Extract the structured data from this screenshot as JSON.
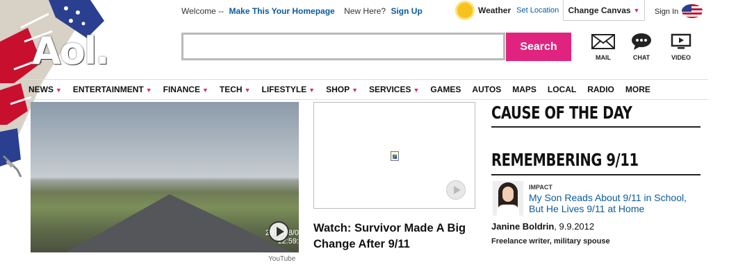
{
  "logo": {
    "text": "Aol."
  },
  "header": {
    "welcome": "Welcome --",
    "homepage_link": "Make This Your Homepage",
    "new_here": "New Here?",
    "signup": "Sign Up",
    "weather_label": "Weather",
    "weather_link": "Set Location",
    "change_canvas": "Change Canvas",
    "sign_in": "Sign In"
  },
  "search": {
    "value": "",
    "button": "Search"
  },
  "utilities": [
    {
      "label": "MAIL",
      "icon": "mail-icon"
    },
    {
      "label": "CHAT",
      "icon": "chat-icon"
    },
    {
      "label": "VIDEO",
      "icon": "video-icon"
    }
  ],
  "nav": [
    {
      "label": "NEWS",
      "dropdown": true
    },
    {
      "label": "ENTERTAINMENT",
      "dropdown": true
    },
    {
      "label": "FINANCE",
      "dropdown": true
    },
    {
      "label": "TECH",
      "dropdown": true
    },
    {
      "label": "LIFESTYLE",
      "dropdown": true
    },
    {
      "label": "SHOP",
      "dropdown": true
    },
    {
      "label": "SERVICES",
      "dropdown": true
    },
    {
      "label": "GAMES",
      "dropdown": false
    },
    {
      "label": "AUTOS",
      "dropdown": false
    },
    {
      "label": "MAPS",
      "dropdown": false
    },
    {
      "label": "LOCAL",
      "dropdown": false
    },
    {
      "label": "RADIO",
      "dropdown": false
    },
    {
      "label": "MORE",
      "dropdown": false
    }
  ],
  "video": {
    "timestamp_line1": "2011/08/0",
    "timestamp_line2": "12:59:",
    "source": "YouTube"
  },
  "feature": {
    "headline": "Watch: Survivor Made A Big Change After 9/11"
  },
  "right": {
    "cause_heading": "CAUSE OF THE DAY",
    "remember_heading": "REMEMBERING 9/11",
    "category": "IMPACT",
    "story_title": "My Son Reads About 9/11 in School, But He Lives 9/11 at Home",
    "author_name": "Janine Boldrin",
    "author_date": ", 9.9.2012",
    "author_role": "Freelance writer, military spouse"
  },
  "colors": {
    "accent": "#e0237e",
    "link": "#0a5a9c"
  }
}
